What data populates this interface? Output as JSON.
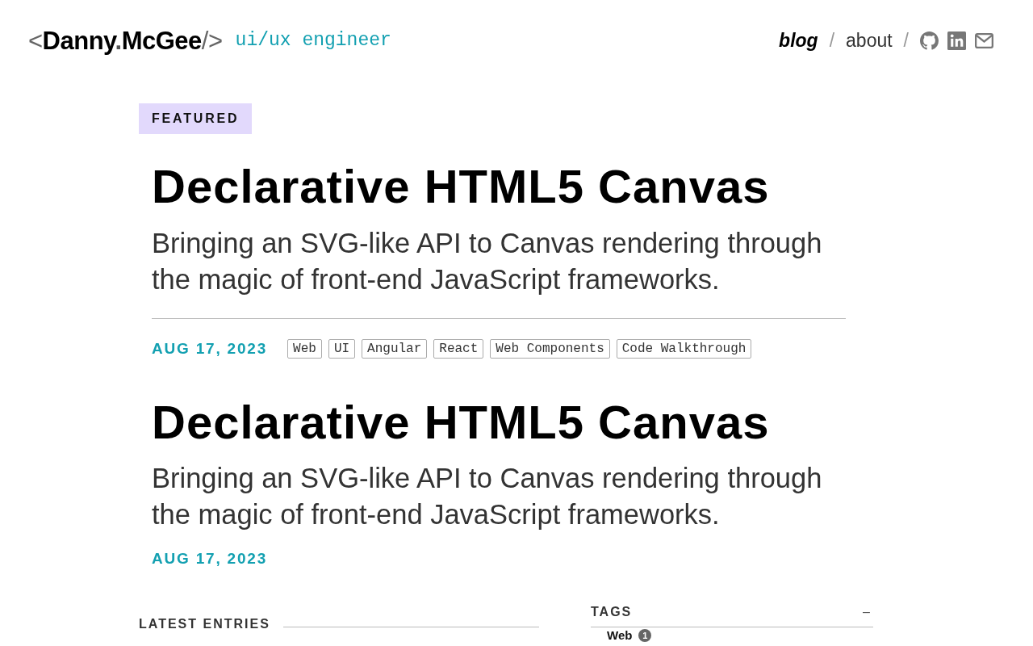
{
  "header": {
    "logo": [
      {
        "kind": "bracket",
        "text": "<"
      },
      {
        "kind": "name",
        "text": "Danny"
      },
      {
        "kind": "bracket",
        "text": "."
      },
      {
        "kind": "name",
        "text": "McGee"
      },
      {
        "kind": "bracket",
        "text": "/>"
      }
    ],
    "tagline": "ui/ux engineer",
    "nav": [
      {
        "kind": "link",
        "label": "blog",
        "selected": true
      },
      {
        "kind": "separator",
        "label": "/"
      },
      {
        "kind": "link",
        "label": "about",
        "selected": false
      },
      {
        "kind": "separator",
        "label": "/"
      }
    ]
  },
  "featured_label": "FEATURED",
  "posts": [
    {
      "title": "Declarative HTML5 Canvas",
      "subtitle": "Bringing an SVG-like API to Canvas rendering through the magic of front-end JavaScript frameworks.",
      "date": "AUG 17, 2023",
      "tags": [
        "Web",
        "UI",
        "Angular",
        "React",
        "Web Components",
        "Code Walkthrough"
      ]
    },
    {
      "title": "Declarative HTML5 Canvas",
      "subtitle": "Bringing an SVG-like API to Canvas rendering through the magic of front-end JavaScript frameworks.",
      "date": "AUG 17, 2023"
    }
  ],
  "latest_entries": {
    "heading": "LATEST ENTRIES"
  },
  "tags_panel": {
    "heading": "TAGS",
    "toggle": "–",
    "items": [
      {
        "label": "Web",
        "count": "1"
      }
    ]
  }
}
